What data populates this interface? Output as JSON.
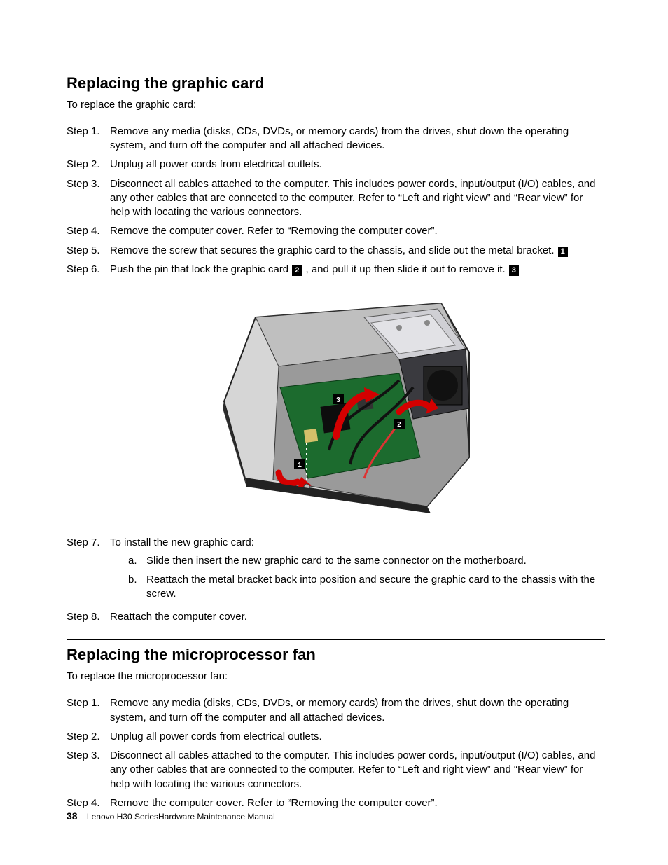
{
  "section1": {
    "title": "Replacing the graphic card",
    "intro": "To replace the graphic card:",
    "steps": [
      {
        "n": "Step 1.",
        "text": "Remove any media (disks, CDs, DVDs, or memory cards) from the drives, shut down the operating system, and turn off the computer and all attached devices."
      },
      {
        "n": "Step 2.",
        "text": "Unplug all power cords from electrical outlets."
      },
      {
        "n": "Step 3.",
        "text": "Disconnect all cables attached to the computer. This includes power cords, input/output (I/O) cables, and any other cables that are connected to the computer. Refer to “Left and right view” and “Rear view” for help with locating the various connectors."
      },
      {
        "n": "Step 4.",
        "text": "Remove the computer cover. Refer to “Removing the computer cover”."
      },
      {
        "n": "Step 5.",
        "text_before": "Remove the screw that secures the graphic card to the chassis, and slide out the metal bracket. ",
        "callout": "1"
      },
      {
        "n": "Step 6.",
        "text_before": "Push the pin that lock the graphic card ",
        "callout_mid": "2",
        "text_mid": " , and pull it up then slide it out to remove it. ",
        "callout_end": "3"
      },
      {
        "n": "Step 7.",
        "text": "To install the new graphic card:",
        "subs": [
          {
            "k": "a.",
            "text": "Slide then insert the new graphic card to the same connector on the motherboard."
          },
          {
            "k": "b.",
            "text": "Reattach the metal bracket back into position and secure the graphic card to the chassis with the screw."
          }
        ]
      },
      {
        "n": "Step 8.",
        "text": "Reattach the computer cover."
      }
    ]
  },
  "section2": {
    "title": "Replacing the microprocessor fan",
    "intro": "To replace the microprocessor fan:",
    "steps": [
      {
        "n": "Step 1.",
        "text": "Remove any media (disks, CDs, DVDs, or memory cards) from the drives, shut down the operating system, and turn off the computer and all attached devices."
      },
      {
        "n": "Step 2.",
        "text": "Unplug all power cords from electrical outlets."
      },
      {
        "n": "Step 3.",
        "text": "Disconnect all cables attached to the computer. This includes power cords, input/output (I/O) cables, and any other cables that are connected to the computer. Refer to “Left and right view” and “Rear view” for help with locating the various connectors."
      },
      {
        "n": "Step 4.",
        "text": "Remove the computer cover. Refer to “Removing the computer cover”."
      }
    ]
  },
  "figure": {
    "alt": "Open desktop chassis showing graphic card removal with callouts 1, 2, 3 and red arrows",
    "callouts": [
      "1",
      "2",
      "3"
    ]
  },
  "footer": {
    "page_number": "38",
    "doc_title": "Lenovo H30 SeriesHardware Maintenance Manual"
  }
}
